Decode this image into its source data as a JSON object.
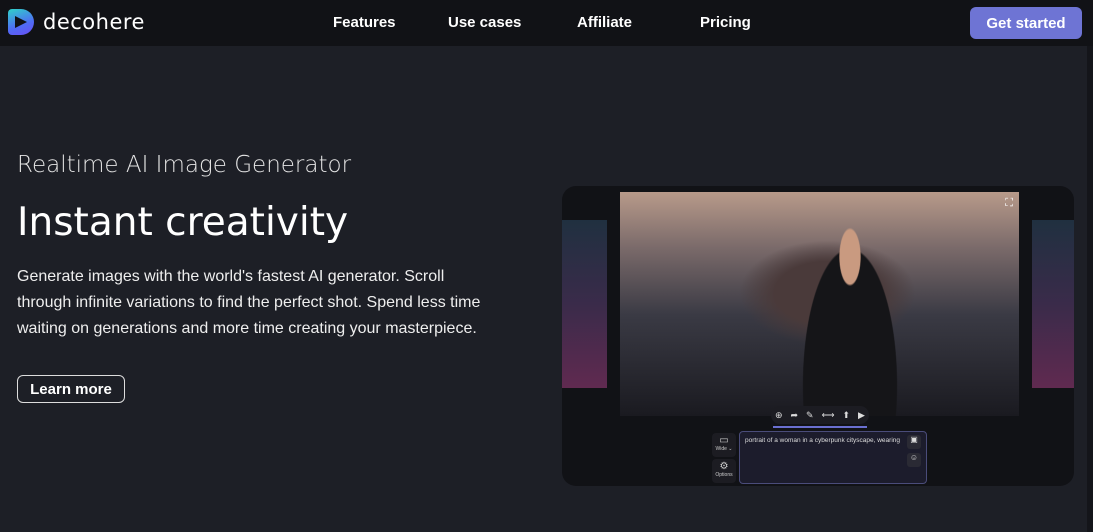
{
  "nav": {
    "brand": "decohere",
    "links": [
      "Features",
      "Use cases",
      "Affiliate",
      "Pricing"
    ],
    "cta": "Get started",
    "cta_color": "#6e74d4"
  },
  "hero": {
    "subtitle": "Realtime AI Image Generator",
    "title": "Instant creativity",
    "description": "Generate images with the world's fastest AI generator. Scroll through infinite variations to find the perfect shot. Spend less time waiting on generations and more time creating your masterpiece.",
    "learn_more": "Learn more"
  },
  "demo": {
    "toolbar_icons": [
      "add-icon",
      "share-icon",
      "edit-icon",
      "variations-icon",
      "upload-icon",
      "video-icon"
    ],
    "wide_label": "Wide ⌄",
    "options_label": "Options",
    "prompt": "portrait of a woman in a cyberpunk cityscape, wearing"
  }
}
